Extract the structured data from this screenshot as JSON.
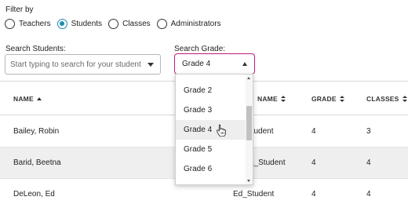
{
  "filter": {
    "label": "Filter by",
    "options": [
      {
        "label": "Teachers",
        "selected": false
      },
      {
        "label": "Students",
        "selected": true
      },
      {
        "label": "Classes",
        "selected": false
      },
      {
        "label": "Administrators",
        "selected": false
      }
    ]
  },
  "search_students": {
    "label": "Search Students:",
    "placeholder": "Start typing to search for your student"
  },
  "search_grade": {
    "label": "Search Grade:",
    "value": "Grade 4",
    "options": [
      "Grade 2",
      "Grade 3",
      "Grade 4",
      "Grade 5",
      "Grade 6"
    ],
    "hovered": "Grade 4"
  },
  "table": {
    "columns": [
      "NAME",
      "NAME",
      "GRADE",
      "CLASSES"
    ],
    "rows": [
      {
        "name": "Bailey, Robin",
        "username": "Student",
        "grade": "4",
        "classes": "3"
      },
      {
        "name": "Barid, Beetna",
        "username": "a_Student",
        "grade": "4",
        "classes": "4"
      },
      {
        "name": "DeLeon, Ed",
        "username": "Ed_Student",
        "grade": "4",
        "classes": "4"
      }
    ]
  },
  "colors": {
    "accent_radio": "#1b8db0",
    "grade_select_border": "#c2187a",
    "row_alt": "#efefef"
  },
  "icons": {
    "sort_name": "sort-ascending-icon",
    "sort_other": "sort-both-icon",
    "student_dropdown": "chevron-down-icon",
    "grade_dropdown": "chevron-up-icon",
    "cursor": "hand-pointer-icon"
  }
}
